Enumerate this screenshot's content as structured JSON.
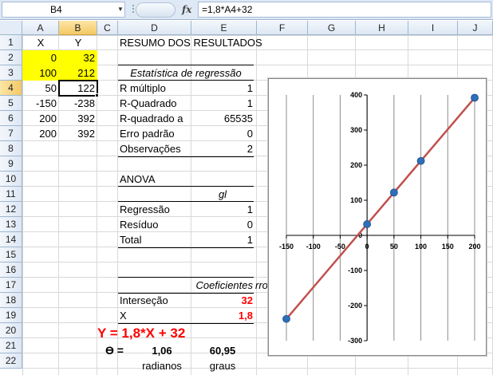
{
  "formula_bar": {
    "name_box": "B4",
    "fx_label": "fx",
    "formula": "=1,8*A4+32"
  },
  "columns": [
    "A",
    "B",
    "C",
    "D",
    "E",
    "F",
    "G",
    "H",
    "I",
    "J"
  ],
  "rows": [
    "1",
    "2",
    "3",
    "4",
    "5",
    "6",
    "7",
    "8",
    "9",
    "10",
    "11",
    "12",
    "13",
    "14",
    "15",
    "16",
    "17",
    "18",
    "19",
    "20",
    "21",
    "22"
  ],
  "sheet": {
    "a1": "X",
    "b1": "Y",
    "a2": "0",
    "b2": "32",
    "a3": "100",
    "b3": "212",
    "a4": "50",
    "b4": "122",
    "a5": "-150",
    "b5": "-238",
    "a6": "200",
    "b6": "392",
    "a7": "200",
    "b7": "392",
    "d1": "RESUMO DOS RESULTADOS",
    "d3": "Estatística de regressão",
    "d4": "R múltiplo",
    "e4": "1",
    "d5": "R-Quadrado",
    "e5": "1",
    "d6": "R-quadrado a",
    "e6": "65535",
    "d7": "Erro padrão",
    "e7": "0",
    "d8": "Observações",
    "e8": "2",
    "d10": "ANOVA",
    "e11": "gl",
    "d12": "Regressão",
    "e12": "1",
    "d13": "Resíduo",
    "e13": "0",
    "d14": "Total",
    "e14": "1",
    "e16": "Coeficientes",
    "f16": "rro",
    "d17": "Interseção",
    "e17": "32",
    "d18": "X",
    "e18": "1,8",
    "b19": "Y = 1,8*X + 32",
    "b20": "Ɵ =",
    "d20": "1,06",
    "e20": "60,95",
    "d21": "radianos",
    "e21": "graus"
  },
  "colors": {
    "highlight": "#ffff00",
    "red_text": "#ff0000",
    "line": "#c0504d",
    "marker": "#2e6fb7"
  },
  "chart_data": {
    "type": "scatter",
    "x": [
      -150,
      0,
      50,
      100,
      200
    ],
    "y": [
      -238,
      32,
      122,
      212,
      392
    ],
    "trendline": {
      "slope": 1.8,
      "intercept": 32
    },
    "xlim": [
      -150,
      200
    ],
    "ylim": [
      -300,
      400
    ],
    "x_ticks": [
      -150,
      -100,
      -50,
      0,
      50,
      100,
      150,
      200
    ],
    "y_ticks": [
      -300,
      -200,
      -100,
      0,
      100,
      200,
      300,
      400
    ],
    "title": "",
    "xlabel": "",
    "ylabel": "",
    "grid": "vertical"
  }
}
